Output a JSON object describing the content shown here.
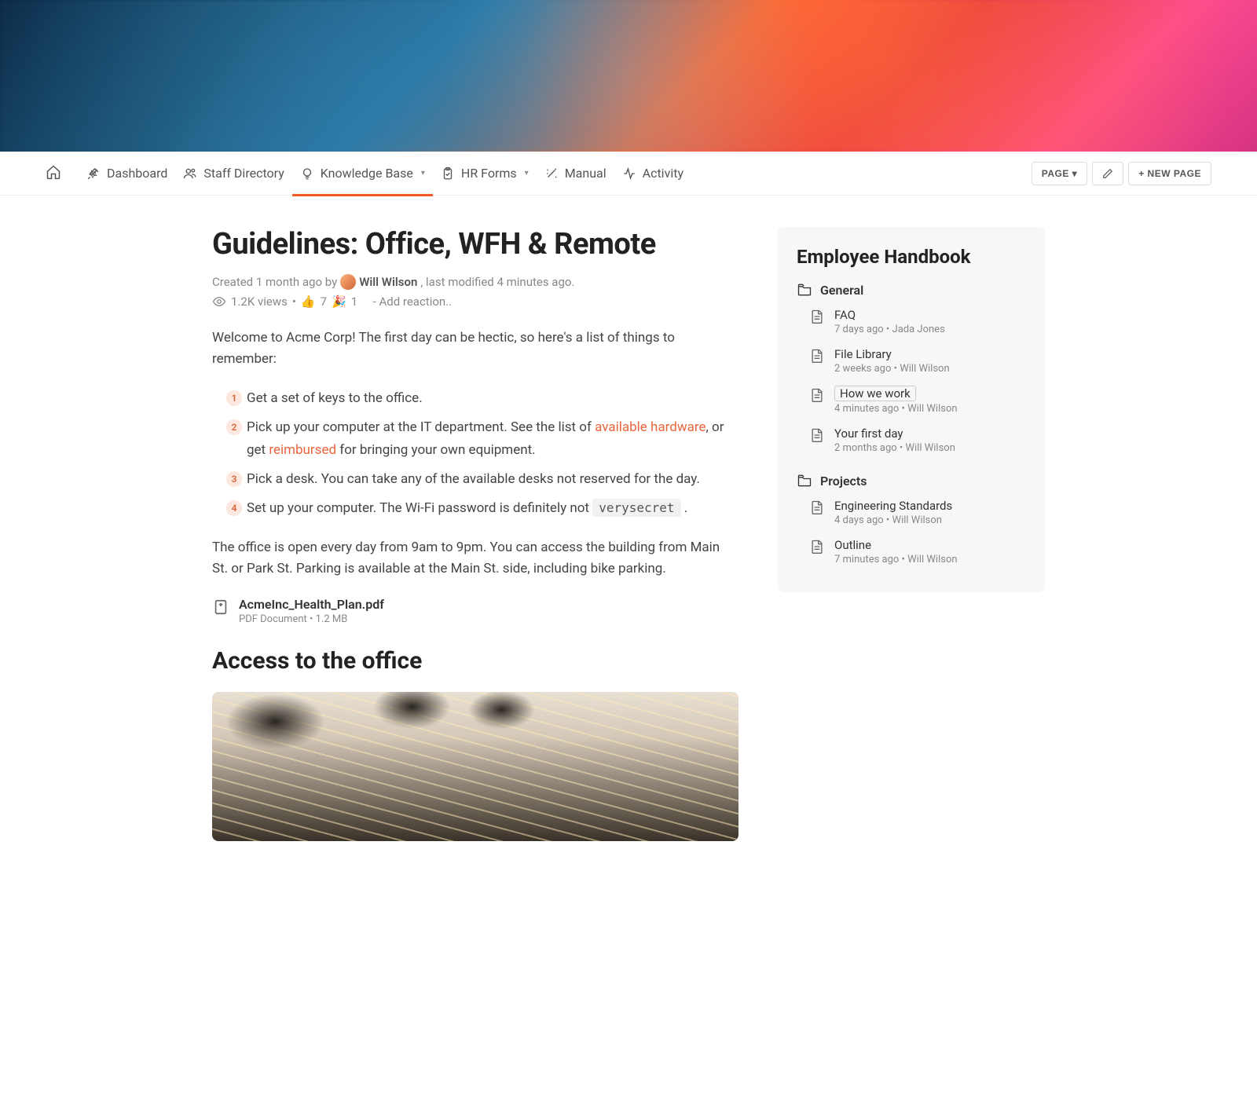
{
  "nav": {
    "items": [
      {
        "label": "Dashboard"
      },
      {
        "label": "Staff Directory"
      },
      {
        "label": "Knowledge Base",
        "dropdown": true,
        "active": true
      },
      {
        "label": "HR Forms",
        "dropdown": true
      },
      {
        "label": "Manual"
      },
      {
        "label": "Activity"
      }
    ],
    "page_btn": "PAGE ▾",
    "new_page_btn": "+ NEW PAGE"
  },
  "page": {
    "title": "Guidelines: Office, WFH & Remote",
    "created_prefix": "Created 1 month ago by",
    "author": "Will Wilson",
    "modified_suffix": ", last modified 4 minutes ago.",
    "views": "1.2K views",
    "reaction_thumb_count": "7",
    "reaction_confetti_count": "1",
    "add_reaction": "- Add reaction..",
    "intro": "Welcome to Acme Corp! The first day can be hectic, so here's a list of things to remember:",
    "steps": [
      {
        "text": "Get a set of keys to the office."
      },
      {
        "pre": "Pick up your computer at the IT department. See the list of ",
        "link1": "available hardware",
        "mid": ", or get ",
        "link2": "reimbursed",
        "post": " for bringing your own equipment."
      },
      {
        "text": "Pick a desk. You can take any of the available desks not reserved for the day."
      },
      {
        "pre4": "Set up your computer. The Wi-Fi password is definitely not ",
        "code": "verysecret",
        "post4": " ."
      }
    ],
    "hours": "The office is open every day from 9am to 9pm. You can access the building from Main St. or Park St. Parking is available at the Main St. side, including bike parking.",
    "attachment": {
      "name": "AcmeInc_Health_Plan.pdf",
      "meta": "PDF Document • 1.2 MB"
    },
    "section_access": "Access to the office"
  },
  "handbook": {
    "title": "Employee Handbook",
    "folders": [
      {
        "name": "General",
        "docs": [
          {
            "title": "FAQ",
            "meta": "7 days ago • Jada Jones"
          },
          {
            "title": "File Library",
            "meta": "2 weeks ago • Will Wilson"
          },
          {
            "title": "How we work",
            "meta": "4 minutes ago • Will Wilson",
            "highlight": true
          },
          {
            "title": "Your first day",
            "meta": "2 months ago • Will Wilson"
          }
        ]
      },
      {
        "name": "Projects",
        "docs": [
          {
            "title": "Engineering Standards",
            "meta": "4 days ago • Will Wilson"
          },
          {
            "title": "Outline",
            "meta": "7 minutes ago • Will Wilson"
          }
        ]
      }
    ]
  }
}
